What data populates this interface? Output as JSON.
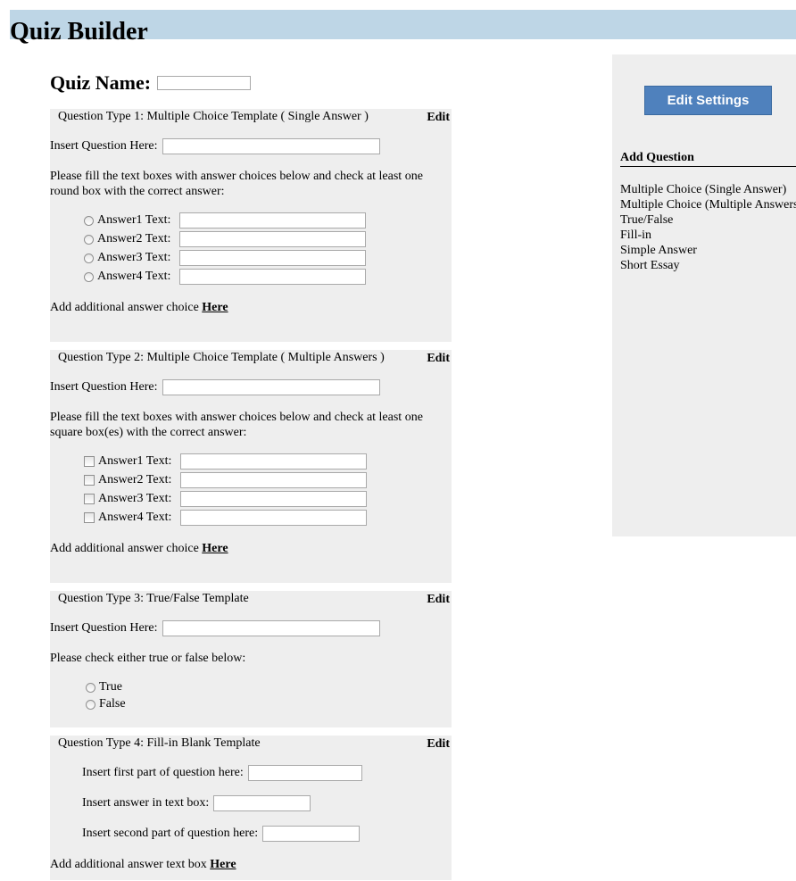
{
  "header": {
    "title": "Quiz Builder"
  },
  "quiz_name": {
    "label": "Quiz Name:",
    "value": ""
  },
  "questions": {
    "q1": {
      "title": "Question Type 1: Multiple Choice Template ( Single Answer )",
      "edit": "Edit",
      "insert_label": "Insert Question Here:",
      "instructions": "Please fill the text boxes with answer choices below and check at least one round box with the correct answer:",
      "answers": [
        "Answer1 Text:",
        "Answer2 Text:",
        "Answer3 Text:",
        "Answer4 Text:"
      ],
      "add_text": "Add additional answer choice",
      "add_link": "Here"
    },
    "q2": {
      "title": "Question Type 2: Multiple Choice Template ( Multiple Answers )",
      "edit": "Edit",
      "insert_label": "Insert Question Here:",
      "instructions": "Please fill the text boxes with answer choices below and check at least one square box(es) with the correct answer:",
      "answers": [
        "Answer1 Text:",
        "Answer2 Text:",
        "Answer3 Text:",
        "Answer4 Text:"
      ],
      "add_text": "Add additional answer choice",
      "add_link": "Here"
    },
    "q3": {
      "title": "Question Type 3: True/False Template",
      "edit": "Edit",
      "insert_label": "Insert Question Here:",
      "instructions": "Please check either true or false below:",
      "options": [
        "True",
        "False"
      ]
    },
    "q4": {
      "title": "Question Type 4: Fill-in Blank Template",
      "edit": "Edit",
      "first_part_label": "Insert first part of question here:",
      "answer_label": "Insert answer in text box:",
      "second_part_label": "Insert second part of question here:",
      "add_text": "Add additional answer text box",
      "add_link": "Here"
    }
  },
  "sidebar": {
    "settings_button": "Edit Settings",
    "add_question_header": "Add Question",
    "items": [
      "Multiple Choice (Single Answer)",
      "Multiple Choice (Multiple Answers)",
      "True/False",
      "Fill-in",
      "Simple Answer",
      "Short Essay"
    ]
  },
  "colors": {
    "header_bg": "#bed6e6",
    "panel_bg": "#eeeeee",
    "button_bg": "#4f81bd"
  }
}
